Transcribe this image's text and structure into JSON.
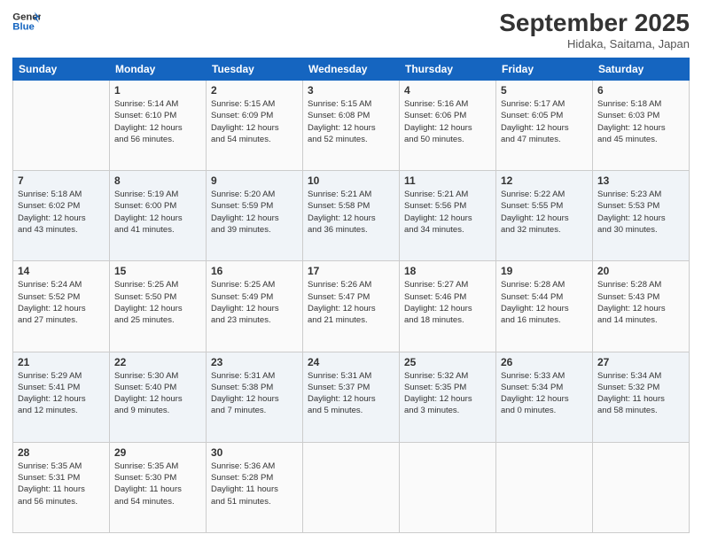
{
  "header": {
    "logo_line1": "General",
    "logo_line2": "Blue",
    "title": "September 2025",
    "subtitle": "Hidaka, Saitama, Japan"
  },
  "days_of_week": [
    "Sunday",
    "Monday",
    "Tuesday",
    "Wednesday",
    "Thursday",
    "Friday",
    "Saturday"
  ],
  "weeks": [
    [
      {
        "day": "",
        "info": ""
      },
      {
        "day": "1",
        "info": "Sunrise: 5:14 AM\nSunset: 6:10 PM\nDaylight: 12 hours\nand 56 minutes."
      },
      {
        "day": "2",
        "info": "Sunrise: 5:15 AM\nSunset: 6:09 PM\nDaylight: 12 hours\nand 54 minutes."
      },
      {
        "day": "3",
        "info": "Sunrise: 5:15 AM\nSunset: 6:08 PM\nDaylight: 12 hours\nand 52 minutes."
      },
      {
        "day": "4",
        "info": "Sunrise: 5:16 AM\nSunset: 6:06 PM\nDaylight: 12 hours\nand 50 minutes."
      },
      {
        "day": "5",
        "info": "Sunrise: 5:17 AM\nSunset: 6:05 PM\nDaylight: 12 hours\nand 47 minutes."
      },
      {
        "day": "6",
        "info": "Sunrise: 5:18 AM\nSunset: 6:03 PM\nDaylight: 12 hours\nand 45 minutes."
      }
    ],
    [
      {
        "day": "7",
        "info": "Sunrise: 5:18 AM\nSunset: 6:02 PM\nDaylight: 12 hours\nand 43 minutes."
      },
      {
        "day": "8",
        "info": "Sunrise: 5:19 AM\nSunset: 6:00 PM\nDaylight: 12 hours\nand 41 minutes."
      },
      {
        "day": "9",
        "info": "Sunrise: 5:20 AM\nSunset: 5:59 PM\nDaylight: 12 hours\nand 39 minutes."
      },
      {
        "day": "10",
        "info": "Sunrise: 5:21 AM\nSunset: 5:58 PM\nDaylight: 12 hours\nand 36 minutes."
      },
      {
        "day": "11",
        "info": "Sunrise: 5:21 AM\nSunset: 5:56 PM\nDaylight: 12 hours\nand 34 minutes."
      },
      {
        "day": "12",
        "info": "Sunrise: 5:22 AM\nSunset: 5:55 PM\nDaylight: 12 hours\nand 32 minutes."
      },
      {
        "day": "13",
        "info": "Sunrise: 5:23 AM\nSunset: 5:53 PM\nDaylight: 12 hours\nand 30 minutes."
      }
    ],
    [
      {
        "day": "14",
        "info": "Sunrise: 5:24 AM\nSunset: 5:52 PM\nDaylight: 12 hours\nand 27 minutes."
      },
      {
        "day": "15",
        "info": "Sunrise: 5:25 AM\nSunset: 5:50 PM\nDaylight: 12 hours\nand 25 minutes."
      },
      {
        "day": "16",
        "info": "Sunrise: 5:25 AM\nSunset: 5:49 PM\nDaylight: 12 hours\nand 23 minutes."
      },
      {
        "day": "17",
        "info": "Sunrise: 5:26 AM\nSunset: 5:47 PM\nDaylight: 12 hours\nand 21 minutes."
      },
      {
        "day": "18",
        "info": "Sunrise: 5:27 AM\nSunset: 5:46 PM\nDaylight: 12 hours\nand 18 minutes."
      },
      {
        "day": "19",
        "info": "Sunrise: 5:28 AM\nSunset: 5:44 PM\nDaylight: 12 hours\nand 16 minutes."
      },
      {
        "day": "20",
        "info": "Sunrise: 5:28 AM\nSunset: 5:43 PM\nDaylight: 12 hours\nand 14 minutes."
      }
    ],
    [
      {
        "day": "21",
        "info": "Sunrise: 5:29 AM\nSunset: 5:41 PM\nDaylight: 12 hours\nand 12 minutes."
      },
      {
        "day": "22",
        "info": "Sunrise: 5:30 AM\nSunset: 5:40 PM\nDaylight: 12 hours\nand 9 minutes."
      },
      {
        "day": "23",
        "info": "Sunrise: 5:31 AM\nSunset: 5:38 PM\nDaylight: 12 hours\nand 7 minutes."
      },
      {
        "day": "24",
        "info": "Sunrise: 5:31 AM\nSunset: 5:37 PM\nDaylight: 12 hours\nand 5 minutes."
      },
      {
        "day": "25",
        "info": "Sunrise: 5:32 AM\nSunset: 5:35 PM\nDaylight: 12 hours\nand 3 minutes."
      },
      {
        "day": "26",
        "info": "Sunrise: 5:33 AM\nSunset: 5:34 PM\nDaylight: 12 hours\nand 0 minutes."
      },
      {
        "day": "27",
        "info": "Sunrise: 5:34 AM\nSunset: 5:32 PM\nDaylight: 11 hours\nand 58 minutes."
      }
    ],
    [
      {
        "day": "28",
        "info": "Sunrise: 5:35 AM\nSunset: 5:31 PM\nDaylight: 11 hours\nand 56 minutes."
      },
      {
        "day": "29",
        "info": "Sunrise: 5:35 AM\nSunset: 5:30 PM\nDaylight: 11 hours\nand 54 minutes."
      },
      {
        "day": "30",
        "info": "Sunrise: 5:36 AM\nSunset: 5:28 PM\nDaylight: 11 hours\nand 51 minutes."
      },
      {
        "day": "",
        "info": ""
      },
      {
        "day": "",
        "info": ""
      },
      {
        "day": "",
        "info": ""
      },
      {
        "day": "",
        "info": ""
      }
    ]
  ]
}
